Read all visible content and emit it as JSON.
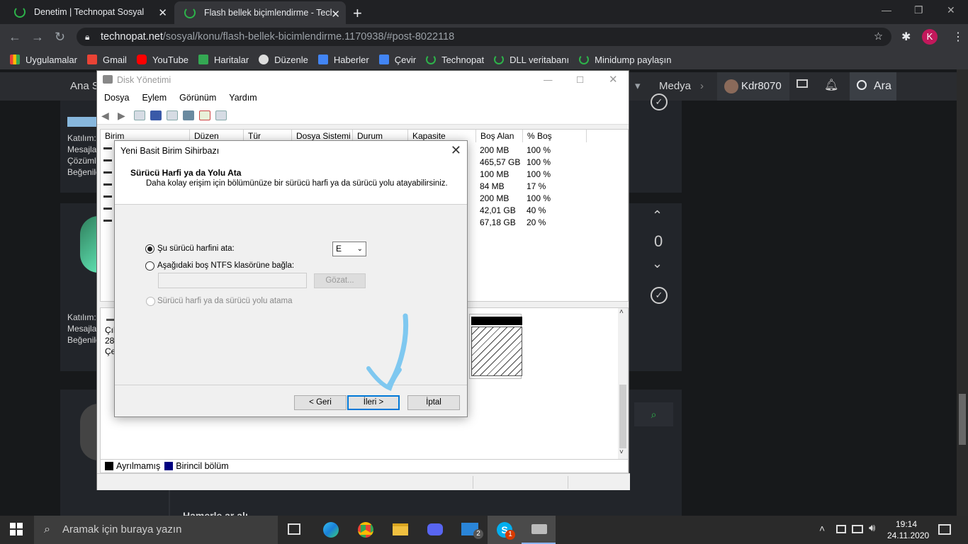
{
  "browser": {
    "tabs": [
      {
        "title": "Denetim | Technopat Sosyal"
      },
      {
        "title": "Flash bellek biçimlendirme - Tech"
      }
    ],
    "url_domain": "technopat.net",
    "url_path": "/sosyal/konu/flash-bellek-bicimlendirme.1170938/#post-8022118",
    "bookmarks": [
      "Uygulamalar",
      "Gmail",
      "YouTube",
      "Haritalar",
      "Düzenle",
      "Haberler",
      "Çevir",
      "Technopat",
      "DLL veritabanı",
      "Minidump paylaşın"
    ],
    "avatar_letter": "K"
  },
  "site": {
    "nav_left": "Ana S",
    "nav_media": "Medya",
    "username": "Kdr8070",
    "search": "Ara",
    "user1": [
      "Katılım:",
      "Mesajla",
      "Çözüml",
      "Beğenile"
    ],
    "user2": [
      "Katılım:",
      "Mesajla",
      "Beğenile"
    ],
    "vote_count": "0",
    "bottom_title": "Hamerle ar alı"
  },
  "disk_mgmt": {
    "title": "Disk Yönetimi",
    "menu": [
      "Dosya",
      "Eylem",
      "Görünüm",
      "Yardım"
    ],
    "columns": [
      "Birim",
      "Düzen",
      "Tür",
      "Dosya Sistemi",
      "Durum",
      "Kapasite",
      "Boş Alan",
      "% Boş"
    ],
    "rows": [
      {
        "free": "200 MB",
        "pct": "100 %"
      },
      {
        "free": "465,57 GB",
        "pct": "100 %"
      },
      {
        "free": "100 MB",
        "pct": "100 %"
      },
      {
        "free": "84 MB",
        "pct": "17 %"
      },
      {
        "free": "200 MB",
        "pct": "100 %"
      },
      {
        "free": "42,01 GB",
        "pct": "40 %"
      },
      {
        "free": "67,18 GB",
        "pct": "20 %"
      }
    ],
    "disk_label": [
      "Çık",
      "28,",
      "Çe"
    ],
    "legend": [
      "Ayrılmamış",
      "Birincil bölüm"
    ],
    "legend_colors": [
      "#000000",
      "#000080"
    ]
  },
  "wizard": {
    "caption": "Yeni Basit Birim Sihirbazı",
    "heading": "Sürücü Harfi ya da Yolu Ata",
    "subheading": "Daha kolay erişim için bölümünüze bir sürücü harfi ya da sürücü yolu atayabilirsiniz.",
    "opt1": "Şu sürücü harfini ata:",
    "drive_letter": "E",
    "opt2": "Aşağıdaki boş NTFS klasörüne bağla:",
    "browse": "Gözat...",
    "opt3": "Sürücü harfi ya da sürücü yolu atama",
    "back": "< Geri",
    "next": "İleri >",
    "cancel": "İptal"
  },
  "taskbar": {
    "search_placeholder": "Aramak için buraya yazın",
    "time": "19:14",
    "date": "24.11.2020",
    "mail_badge": "2",
    "skype_badge": "1"
  },
  "colors": {
    "accent_green": "#2db34a",
    "annotation_arrow": "#7fc8f0"
  }
}
